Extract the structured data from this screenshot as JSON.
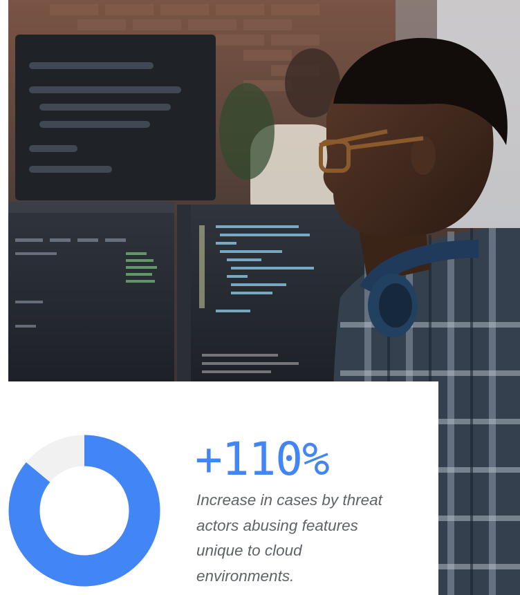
{
  "stat": {
    "value": "+110%",
    "caption": "Increase in cases by threat actors abusing features unique to cloud environments.",
    "share": 0.86
  },
  "colors": {
    "accent": "#4285f4",
    "donut_track": "#f1f1f1",
    "caption_text": "#5f6368",
    "card_background": "#ffffff"
  }
}
